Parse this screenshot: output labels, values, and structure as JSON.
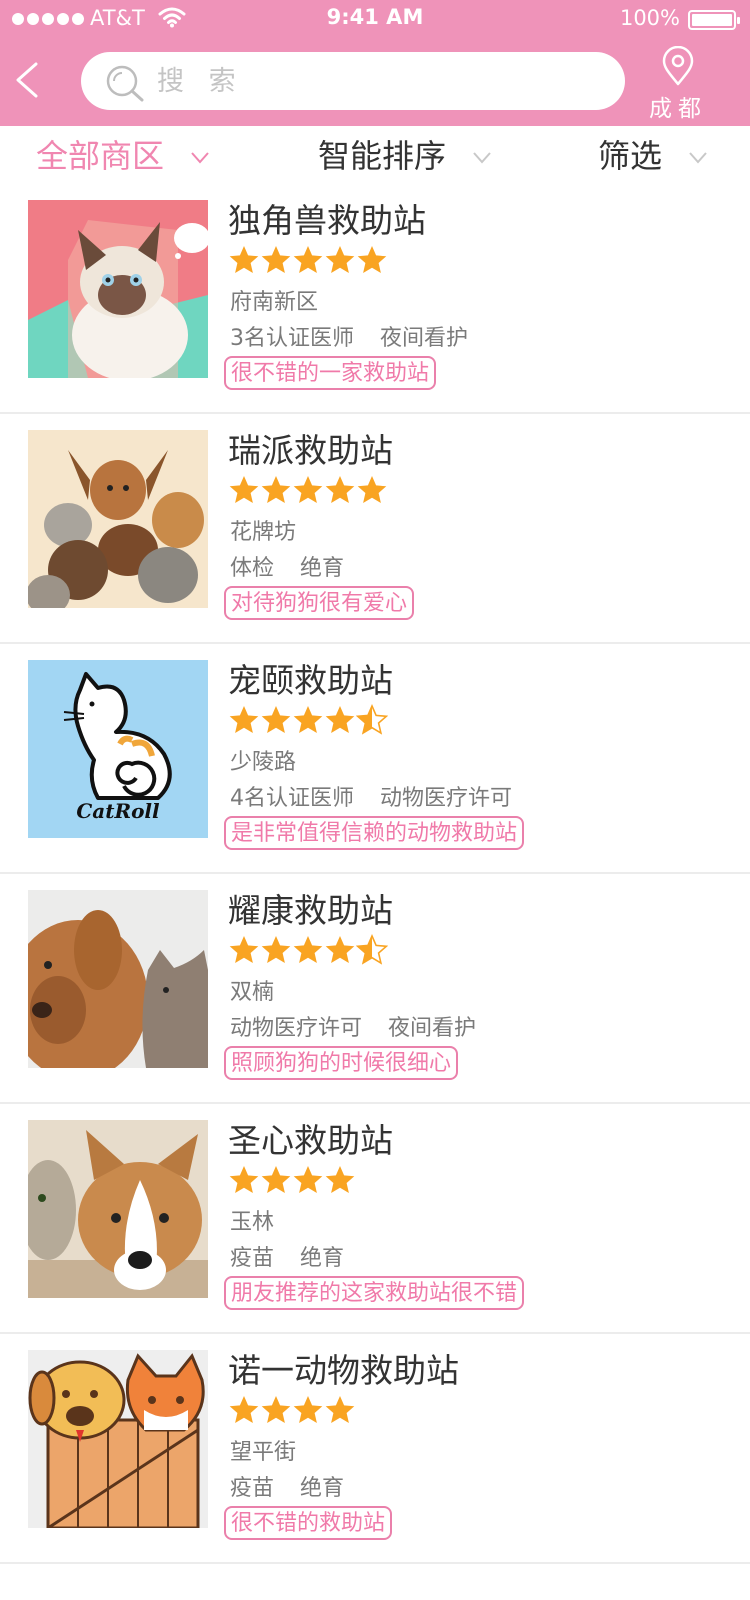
{
  "status": {
    "carrier": "AT&T",
    "time": "9:41 AM",
    "battery": "100%"
  },
  "header": {
    "search_placeholder": "搜 索",
    "city": "成都"
  },
  "filters": [
    {
      "label": "全部商区",
      "active": true
    },
    {
      "label": "智能排序",
      "active": false
    },
    {
      "label": "筛选",
      "active": false
    }
  ],
  "colors": {
    "brand": "#ef93b9",
    "accent": "#f086b0",
    "star": "#f9a422"
  },
  "stations": [
    {
      "name": "独角兽救助站",
      "rating": 5,
      "area": "府南新区",
      "tags": [
        "3名认证医师",
        "夜间看护"
      ],
      "review": "很不错的一家救助站",
      "image": "siamese-cat-photo"
    },
    {
      "name": "瑞派救助站",
      "rating": 5,
      "area": "花牌坊",
      "tags": [
        "体检",
        "绝育"
      ],
      "review": "对待狗狗很有爱心",
      "image": "dogs-and-cats-group-photo"
    },
    {
      "name": "宠颐救助站",
      "rating": 4.5,
      "area": "少陵路",
      "tags": [
        "4名认证医师",
        "动物医疗许可"
      ],
      "review": "是非常值得信赖的动物救助站",
      "image": "catroll-logo",
      "logo_text": "CatRoll"
    },
    {
      "name": "耀康救助站",
      "rating": 4.5,
      "area": "双楠",
      "tags": [
        "动物医疗许可",
        "夜间看护"
      ],
      "review": "照顾狗狗的时候很细心",
      "image": "puppy-and-cat-photo"
    },
    {
      "name": "圣心救助站",
      "rating": 4,
      "area": "玉林",
      "tags": [
        "疫苗",
        "绝育"
      ],
      "review": "朋友推荐的这家救助站很不错",
      "image": "corgi-and-cat-photo"
    },
    {
      "name": "诺一动物救助站",
      "rating": 4,
      "area": "望平街",
      "tags": [
        "疫苗",
        "绝育"
      ],
      "review": "很不错的救助站",
      "image": "cartoon-dog-cat-fence"
    }
  ]
}
